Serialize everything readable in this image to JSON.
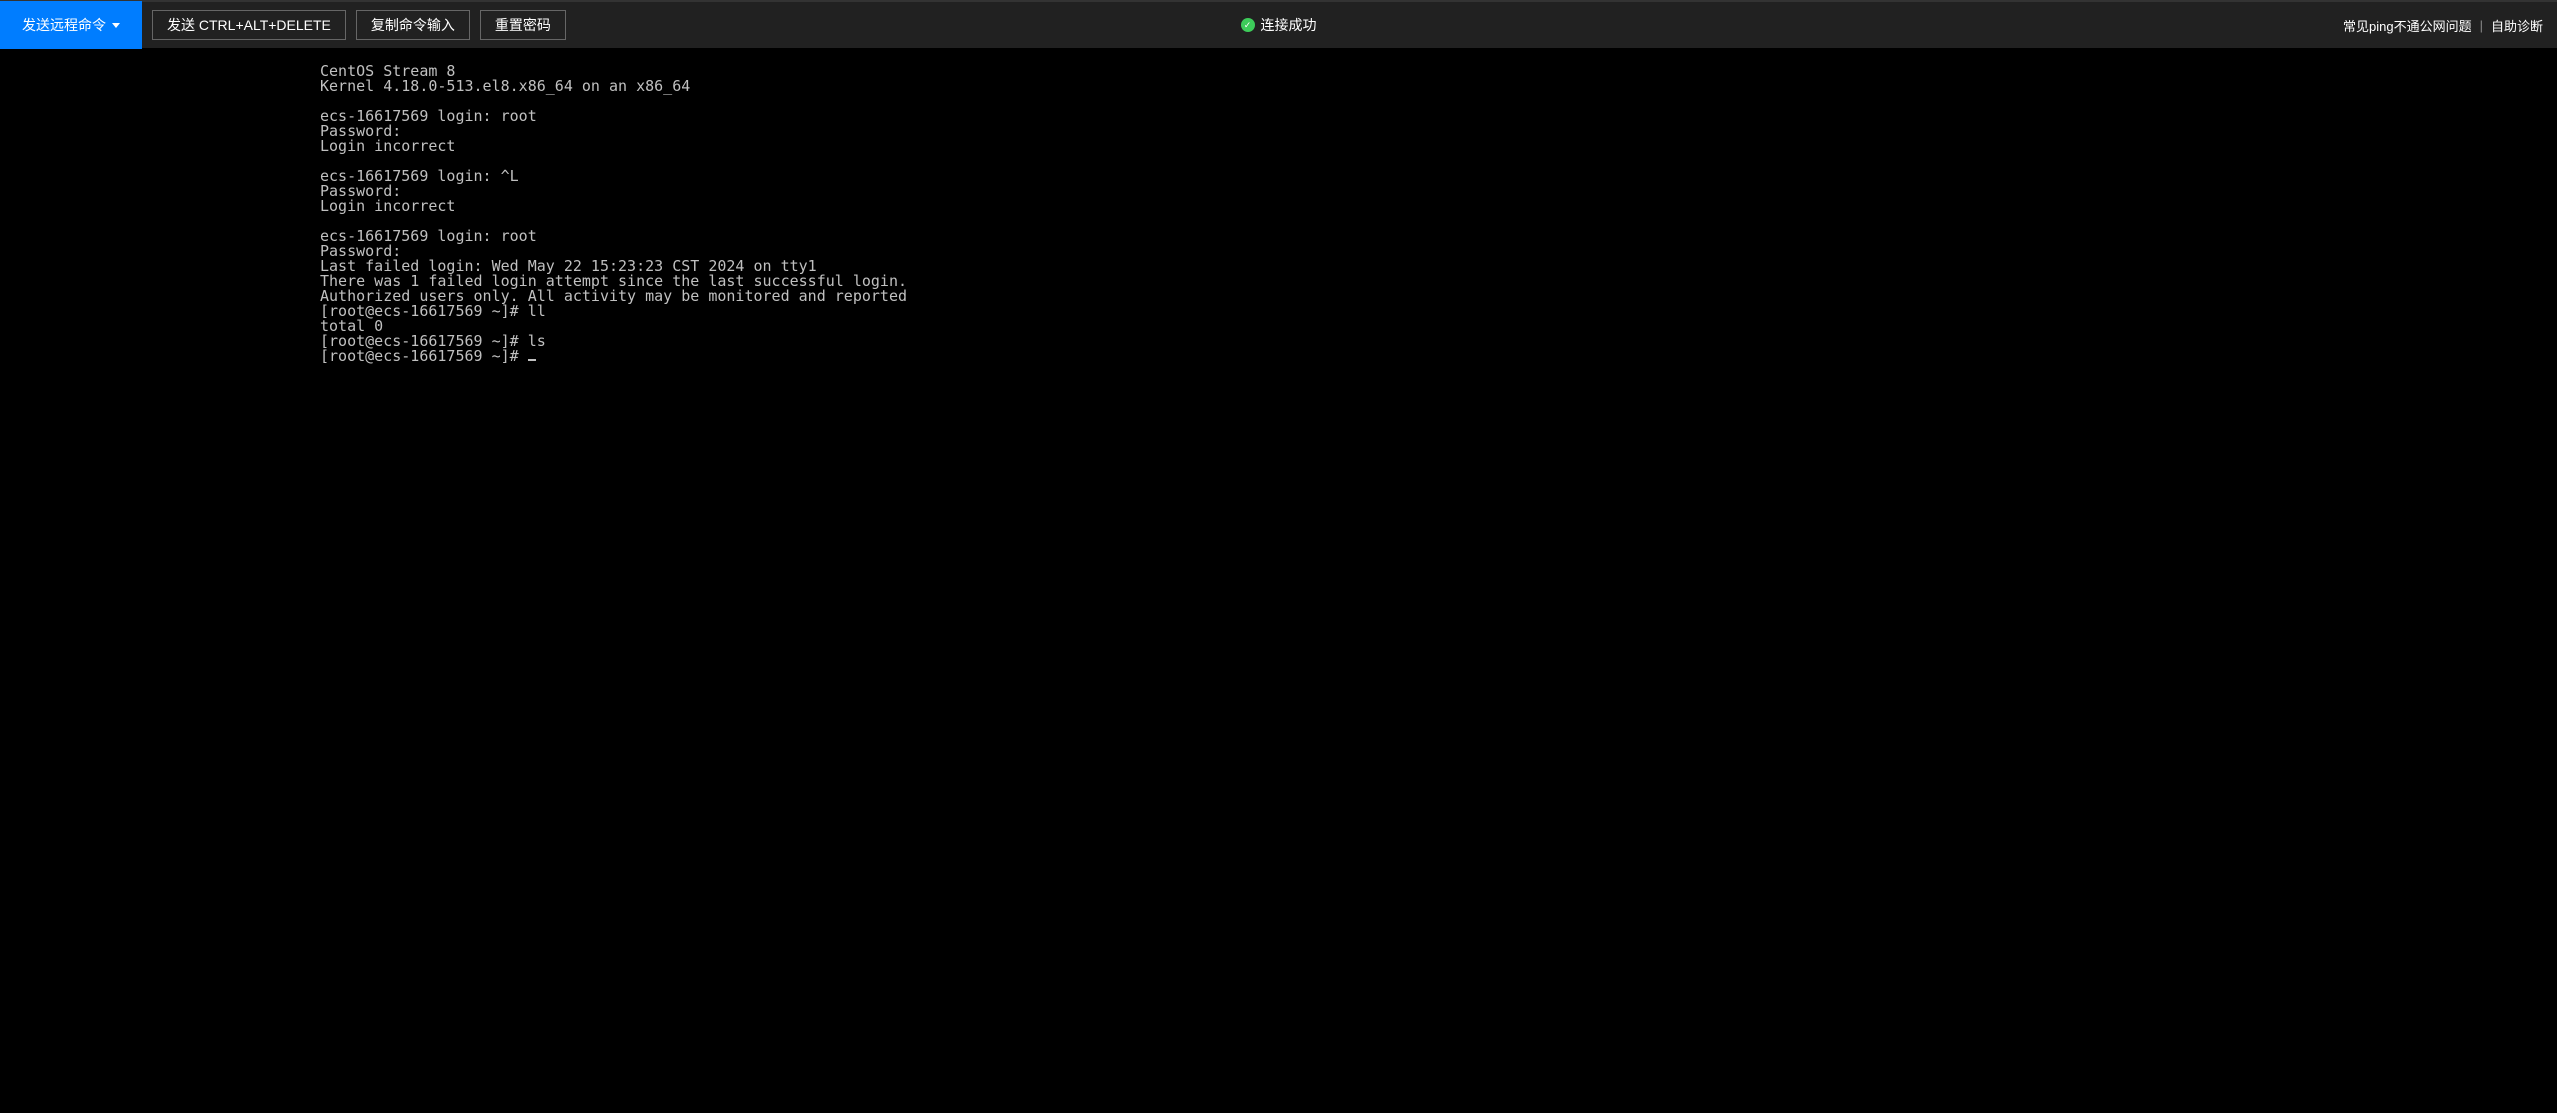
{
  "toolbar": {
    "send_remote_cmd": "发送远程命令",
    "send_cad": "发送 CTRL+ALT+DELETE",
    "copy_input": "复制命令输入",
    "reset_password": "重置密码"
  },
  "status": {
    "text": "连接成功"
  },
  "right": {
    "ping_issue": "常见ping不通公网问题",
    "self_diag": "自助诊断"
  },
  "terminal": {
    "lines": [
      "CentOS Stream 8",
      "Kernel 4.18.0-513.el8.x86_64 on an x86_64",
      "",
      "ecs-16617569 login: root",
      "Password:",
      "Login incorrect",
      "",
      "ecs-16617569 login: ^L",
      "Password:",
      "Login incorrect",
      "",
      "ecs-16617569 login: root",
      "Password:",
      "Last failed login: Wed May 22 15:23:23 CST 2024 on tty1",
      "There was 1 failed login attempt since the last successful login.",
      "Authorized users only. All activity may be monitored and reported",
      "[root@ecs-16617569 ~]# ll",
      "total 0",
      "[root@ecs-16617569 ~]# ls",
      "[root@ecs-16617569 ~]# "
    ]
  }
}
